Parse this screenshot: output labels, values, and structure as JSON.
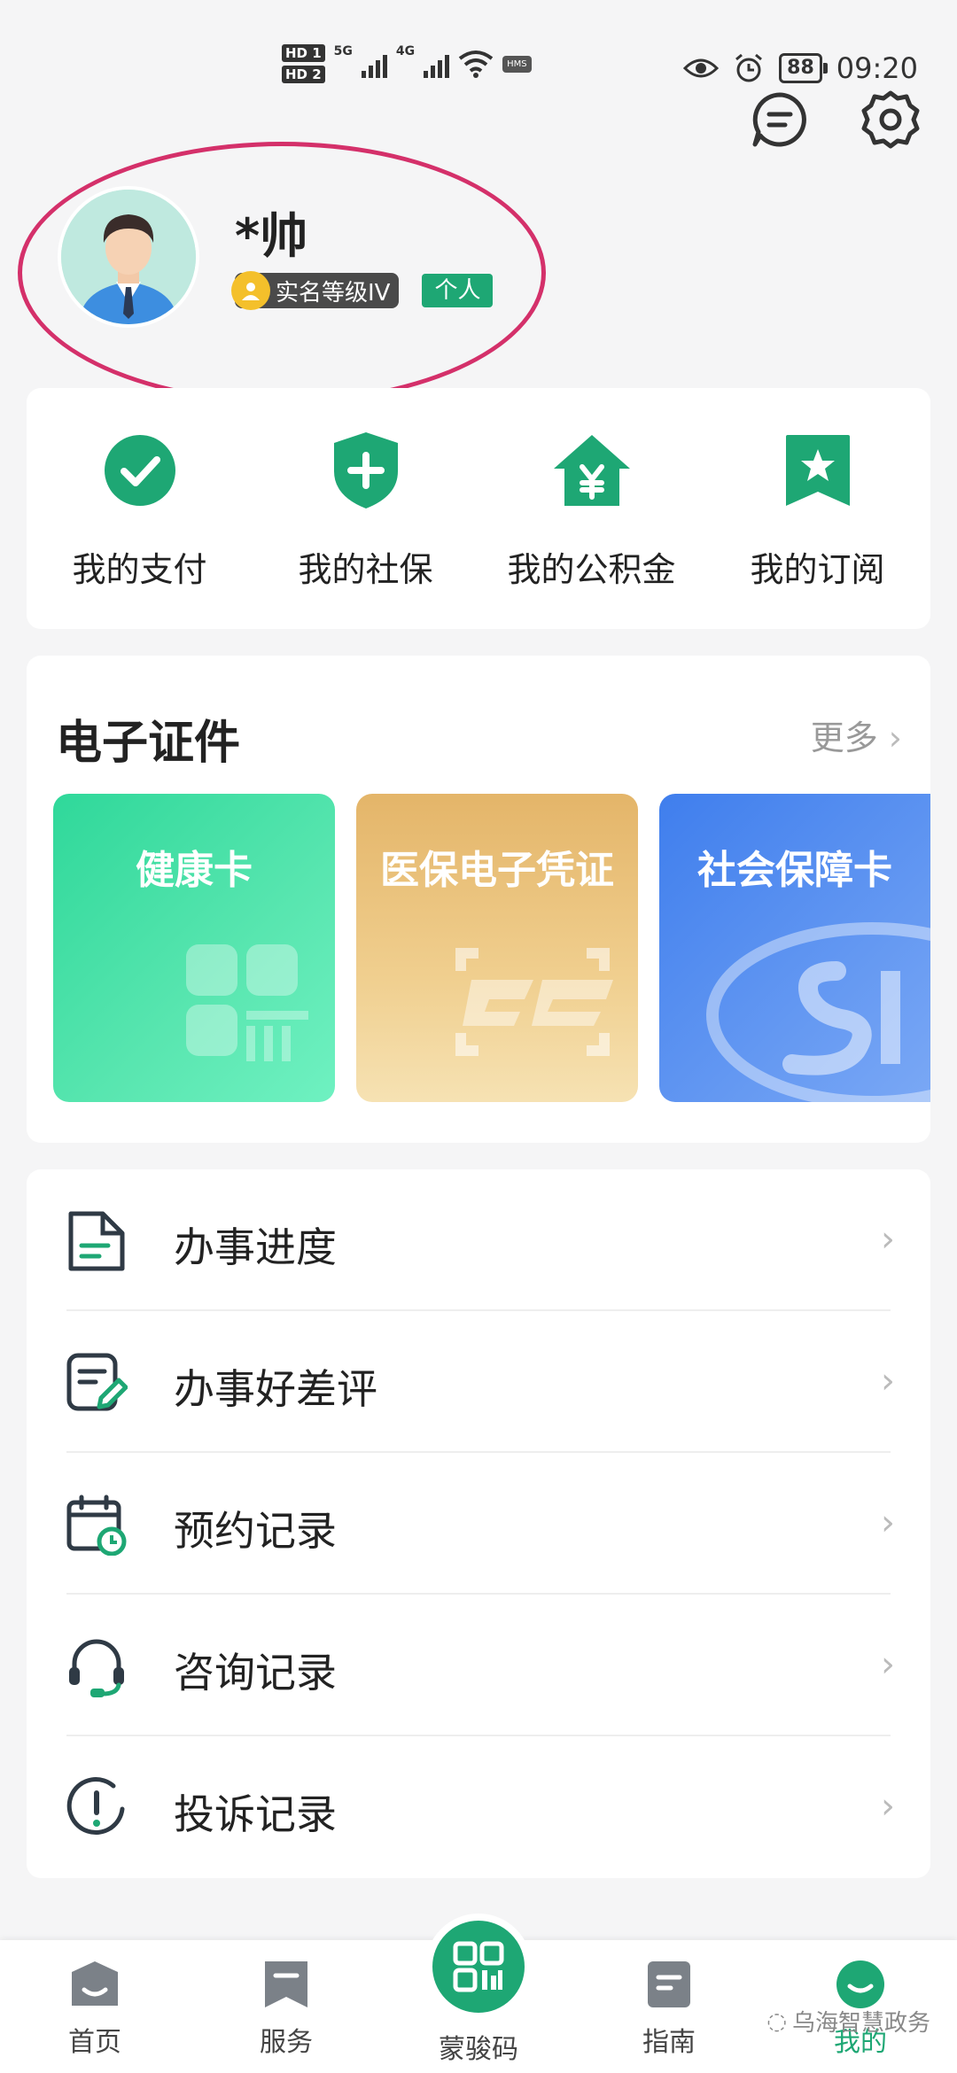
{
  "status_bar": {
    "hd1": "HD 1",
    "hd2": "HD 2",
    "net1": "5G",
    "net2": "4G",
    "hms": "HMS",
    "battery": "88",
    "time": "09:20"
  },
  "profile": {
    "name": "*帅",
    "real_name_level": "实名等级IV",
    "account_type": "个人"
  },
  "quick_actions": [
    {
      "label": "我的支付",
      "icon": "check-circle-icon"
    },
    {
      "label": "我的社保",
      "icon": "shield-plus-icon"
    },
    {
      "label": "我的公积金",
      "icon": "house-yen-icon"
    },
    {
      "label": "我的订阅",
      "icon": "bookmark-star-icon"
    }
  ],
  "e_certificates": {
    "title": "电子证件",
    "more": "更多",
    "items": [
      {
        "label": "健康卡"
      },
      {
        "label": "医保电子凭证"
      },
      {
        "label": "社会保障卡"
      }
    ]
  },
  "menu": [
    {
      "label": "办事进度",
      "icon": "document-icon"
    },
    {
      "label": "办事好差评",
      "icon": "review-edit-icon"
    },
    {
      "label": "预约记录",
      "icon": "calendar-clock-icon"
    },
    {
      "label": "咨询记录",
      "icon": "headset-icon"
    },
    {
      "label": "投诉记录",
      "icon": "exclamation-circle-icon"
    }
  ],
  "bottom_nav": {
    "home": "首页",
    "service": "服务",
    "code": "蒙骏码",
    "guide": "指南",
    "mine": "我的"
  },
  "watermark": "乌海智慧政务",
  "colors": {
    "accent": "#1ea774",
    "highlight_ring": "#d4306a"
  }
}
